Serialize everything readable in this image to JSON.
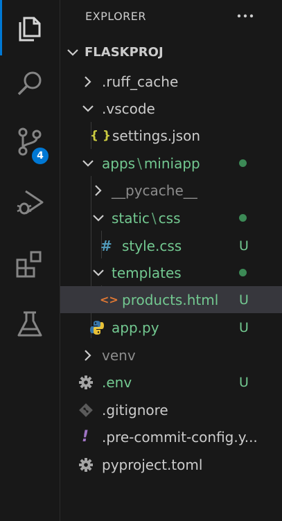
{
  "activity_bar": {
    "items": [
      {
        "name": "explorer",
        "icon": "files-icon",
        "active": true
      },
      {
        "name": "search",
        "icon": "search-icon"
      },
      {
        "name": "source-control",
        "icon": "source-control-icon",
        "badge": "4"
      },
      {
        "name": "run-debug",
        "icon": "run-debug-icon"
      },
      {
        "name": "extensions",
        "icon": "extensions-icon"
      },
      {
        "name": "testing",
        "icon": "flask-icon"
      }
    ]
  },
  "explorer": {
    "title": "EXPLORER",
    "project": "FLASKPROJ",
    "items": [
      {
        "label": ".ruff_cache"
      },
      {
        "label": ".vscode"
      },
      {
        "label": "settings.json",
        "icon_text": "{ }"
      },
      {
        "label_parts": [
          "apps",
          "\\",
          "miniapp"
        ]
      },
      {
        "label": "__pycache__"
      },
      {
        "label_parts": [
          "static",
          "\\",
          "css"
        ]
      },
      {
        "label": "style.css",
        "icon_text": "#",
        "git": "U"
      },
      {
        "label": "templates"
      },
      {
        "label": "products.html",
        "icon_text": "<>",
        "git": "U"
      },
      {
        "label": "app.py",
        "git": "U"
      },
      {
        "label": "venv"
      },
      {
        "label": ".env",
        "git": "U"
      },
      {
        "label": ".gitignore"
      },
      {
        "label": ".pre-commit-config.y...",
        "icon_text": "!"
      },
      {
        "label": "pyproject.toml"
      }
    ]
  },
  "colors": {
    "accent": "#0078d4",
    "git_untracked": "#73c991",
    "json_icon": "#cbcb41",
    "css_icon": "#519aba",
    "html_icon": "#e37933",
    "yaml_icon": "#a074c4"
  }
}
